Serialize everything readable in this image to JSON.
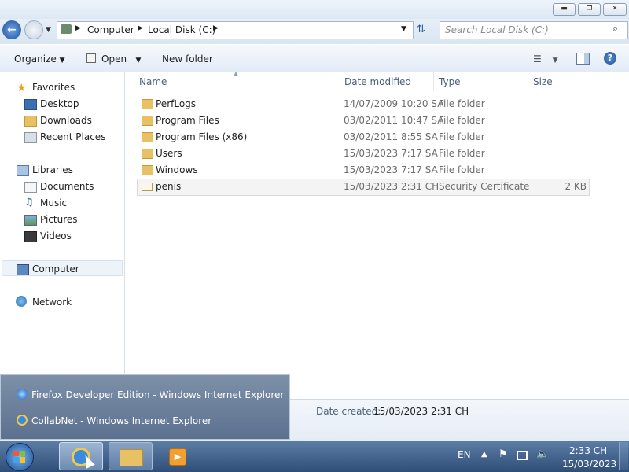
{
  "window": {
    "caption_buttons": [
      "minimize",
      "maximize",
      "close"
    ]
  },
  "address": {
    "crumbs": [
      "Computer",
      "Local Disk (C:)"
    ],
    "search_placeholder": "Search Local Disk (C:)"
  },
  "toolbar": {
    "organize": "Organize",
    "open": "Open",
    "new_folder": "New folder"
  },
  "sidebar": {
    "favorites": "Favorites",
    "favorites_items": [
      "Desktop",
      "Downloads",
      "Recent Places"
    ],
    "libraries": "Libraries",
    "libraries_items": [
      "Documents",
      "Music",
      "Pictures",
      "Videos"
    ],
    "computer": "Computer",
    "network": "Network"
  },
  "columns": {
    "name": "Name",
    "date": "Date modified",
    "type": "Type",
    "size": "Size"
  },
  "files": [
    {
      "name": "PerfLogs",
      "date": "14/07/2009 10:20 SA",
      "type": "File folder",
      "size": "",
      "icon": "folder-icon"
    },
    {
      "name": "Program Files",
      "date": "03/02/2011 10:47 SA",
      "type": "File folder",
      "size": "",
      "icon": "folder-icon"
    },
    {
      "name": "Program Files (x86)",
      "date": "03/02/2011 8:55 SA",
      "type": "File folder",
      "size": "",
      "icon": "folder-icon"
    },
    {
      "name": "Users",
      "date": "15/03/2023 7:17 SA",
      "type": "File folder",
      "size": "",
      "icon": "folder-icon"
    },
    {
      "name": "Windows",
      "date": "15/03/2023 7:17 SA",
      "type": "File folder",
      "size": "",
      "icon": "folder-icon"
    },
    {
      "name": "penis",
      "date": "15/03/2023 2:31 CH",
      "type": "Security Certificate",
      "size": "2 KB",
      "icon": "certificate-icon"
    }
  ],
  "details": {
    "date_created_label": "Date created:",
    "date_created_value": "15/03/2023 2:31 CH"
  },
  "taskbar_popup": {
    "items": [
      "Firefox Developer Edition - Windows Internet Explorer",
      "CollabNet - Windows Internet Explorer"
    ]
  },
  "tray": {
    "language": "EN",
    "time": "2:33 CH",
    "date": "15/03/2023"
  },
  "colors": {
    "taskbar": "#2f4e78",
    "popup": "#6a7f9c",
    "folder": "#e8c165",
    "header_text": "#4c607a"
  }
}
